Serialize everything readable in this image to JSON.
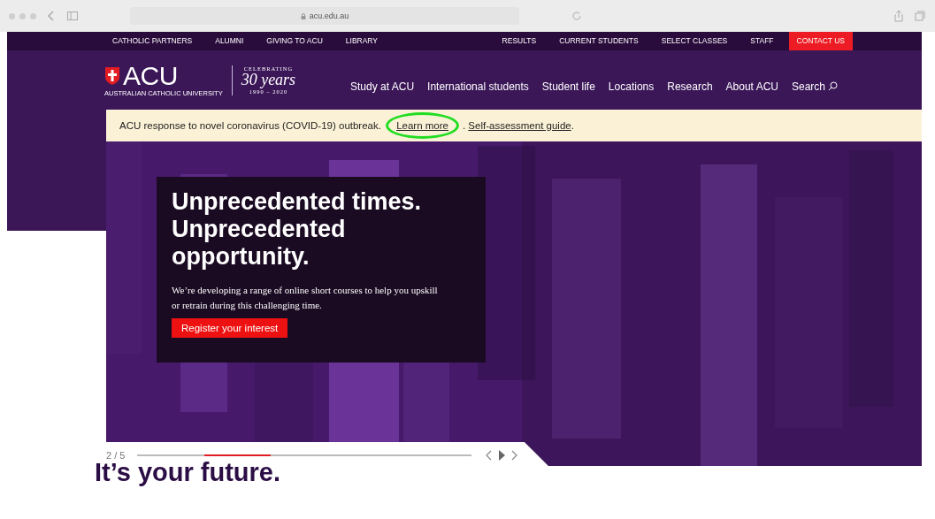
{
  "browser": {
    "url": "acu.edu.au"
  },
  "utility_nav": {
    "left": [
      {
        "label": "CATHOLIC PARTNERS",
        "kind": "link"
      },
      {
        "label": "ALUMNI",
        "kind": "link"
      },
      {
        "label": "GIVING TO ACU",
        "kind": "link"
      },
      {
        "label": "LIBRARY",
        "kind": "link"
      }
    ],
    "right": [
      {
        "label": "RESULTS",
        "kind": "link"
      },
      {
        "label": "CURRENT STUDENTS",
        "kind": "link"
      },
      {
        "label": "SELECT CLASSES",
        "kind": "link"
      },
      {
        "label": "STAFF",
        "kind": "link"
      },
      {
        "label": "CONTACT US",
        "kind": "button"
      }
    ]
  },
  "logo": {
    "name": "ACU",
    "subtitle": "AUSTRALIAN CATHOLIC UNIVERSITY",
    "badge_top": "CELEBRATING",
    "badge_main": "30 years",
    "badge_years": "1990 – 2020"
  },
  "main_nav": [
    "Study at ACU",
    "International students",
    "Student life",
    "Locations",
    "Research",
    "About ACU"
  ],
  "search": {
    "label": "Search"
  },
  "alert": [
    {
      "kind": "text",
      "text": "ACU response to novel coronavirus (COVID-19) outbreak. "
    },
    {
      "kind": "link",
      "text": "Learn more",
      "circled": true
    },
    {
      "kind": "text",
      "text": ". "
    },
    {
      "kind": "link",
      "text": "Self-assessment guide",
      "circled": false
    },
    {
      "kind": "text",
      "text": "."
    }
  ],
  "hero": {
    "kind": "picture",
    "heading": "Unprecedented times. Unprecedented opportunity.",
    "body": "We’re developing a range of online short courses to help you upskill or retrain during this challenging time.",
    "button": "Register your interest"
  },
  "slider": {
    "counter": "2 / 5",
    "segments": [
      {
        "selected": false
      },
      {
        "selected": true
      },
      {
        "selected": false
      },
      {
        "selected": false
      },
      {
        "selected": false
      }
    ]
  },
  "section_heading": "It’s your future."
}
